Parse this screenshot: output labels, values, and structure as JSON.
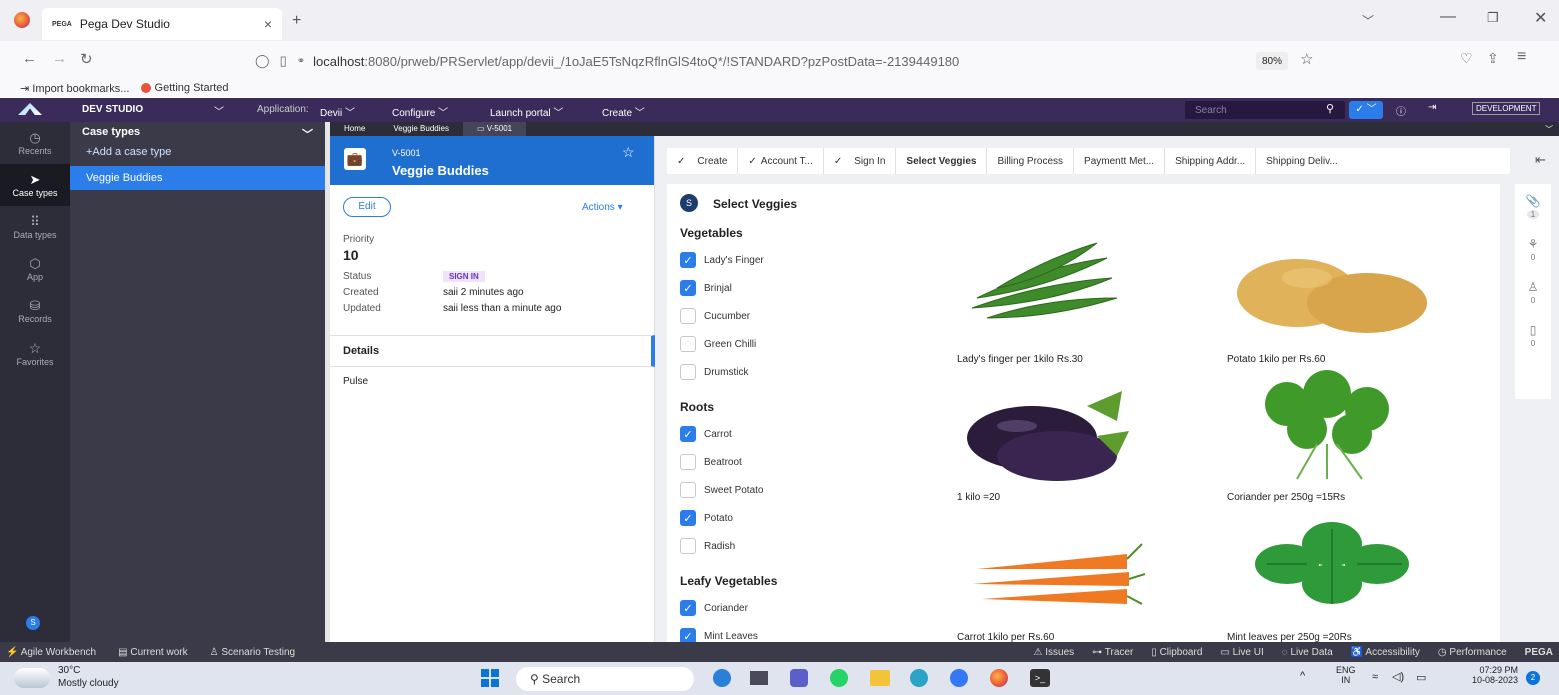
{
  "browser": {
    "tab_title": "Pega Dev Studio",
    "tab_prefix": "PEGA",
    "url_host": "localhost",
    "url_rest": ":8080/prweb/PRServlet/app/devii_/1oJaE5TsNqzRflnGlS4toQ*/!STANDARD?pzPostData=-2139449180",
    "zoom": "80%",
    "bookmarks": [
      "Import bookmarks...",
      "Getting Started"
    ]
  },
  "header": {
    "studio": "DEV STUDIO",
    "application_label": "Application:",
    "application_value": "Devii",
    "menus": [
      "Configure",
      "Launch portal",
      "Create"
    ],
    "search_placeholder": "Search",
    "environment": "DEVELOPMENT"
  },
  "nav": {
    "items": [
      {
        "label": "Recents",
        "icon": "clock-icon"
      },
      {
        "label": "Case types",
        "icon": "case-types-icon"
      },
      {
        "label": "Data types",
        "icon": "grid-icon"
      },
      {
        "label": "App",
        "icon": "cube-icon"
      },
      {
        "label": "Records",
        "icon": "records-icon"
      },
      {
        "label": "Favorites",
        "icon": "star-icon"
      }
    ],
    "avatar": "S"
  },
  "case_types": {
    "title": "Case types",
    "add_label": "+Add a case type",
    "items": [
      "Veggie Buddies"
    ]
  },
  "work_tabs": [
    "Home",
    "Veggie Buddies",
    "V-5001"
  ],
  "case": {
    "id": "V-5001",
    "name": "Veggie Buddies",
    "edit_label": "Edit",
    "actions_label": "Actions",
    "priority_label": "Priority",
    "priority_value": "10",
    "status_label": "Status",
    "status_value": "SIGN IN",
    "created_label": "Created",
    "created_value": "saii 2 minutes ago",
    "updated_label": "Updated",
    "updated_value": "saii less than a minute ago",
    "sections": [
      "Details",
      "Pulse"
    ]
  },
  "stages": [
    {
      "label": "Create",
      "done": true
    },
    {
      "label": "Account T...",
      "done": true
    },
    {
      "label": "Sign In",
      "done": true
    },
    {
      "label": "Select Veggies",
      "done": false,
      "active": true
    },
    {
      "label": "Billing Process",
      "done": false
    },
    {
      "label": "Paymentt Met...",
      "done": false
    },
    {
      "label": "Shipping Addr...",
      "done": false
    },
    {
      "label": "Shipping Deliv...",
      "done": false
    }
  ],
  "form": {
    "badge": "S",
    "title": "Select Veggies",
    "groups": [
      {
        "title": "Vegetables",
        "options": [
          {
            "label": "Lady's Finger",
            "checked": true
          },
          {
            "label": "Brinjal",
            "checked": true
          },
          {
            "label": "Cucumber",
            "checked": false
          },
          {
            "label": "Green Chilli",
            "checked": false
          },
          {
            "label": "Drumstick",
            "checked": false
          }
        ]
      },
      {
        "title": "Roots",
        "options": [
          {
            "label": "Carrot",
            "checked": true
          },
          {
            "label": "Beatroot",
            "checked": false
          },
          {
            "label": "Sweet Potato",
            "checked": false
          },
          {
            "label": "Potato",
            "checked": true
          },
          {
            "label": "Radish",
            "checked": false
          }
        ]
      },
      {
        "title": "Leafy Vegetables",
        "options": [
          {
            "label": "Coriander",
            "checked": true
          },
          {
            "label": "Mint Leaves",
            "checked": true
          }
        ]
      }
    ],
    "products": [
      {
        "caption": "Lady's finger per 1kilo Rs.30",
        "image": "okra"
      },
      {
        "caption": "Potato 1kilo per Rs.60",
        "image": "potato"
      },
      {
        "caption": "1 kilo =20",
        "image": "brinjal"
      },
      {
        "caption": "Coriander per 250g =15Rs",
        "image": "coriander"
      },
      {
        "caption": "Carrot 1kilo per Rs.60",
        "image": "carrot"
      },
      {
        "caption": "Mint leaves per 250g =20Rs",
        "image": "mint"
      }
    ]
  },
  "right_rail": [
    {
      "icon": "paperclip-icon",
      "count": "1"
    },
    {
      "icon": "tag-icon",
      "count": "0"
    },
    {
      "icon": "followers-icon",
      "count": "0"
    },
    {
      "icon": "clipboard-icon",
      "count": "0"
    }
  ],
  "devbar": {
    "left": [
      "Agile Workbench",
      "Current work",
      "Scenario Testing"
    ],
    "right": [
      "Issues",
      "Tracer",
      "Clipboard",
      "Live UI",
      "Live Data",
      "Accessibility",
      "Performance"
    ],
    "brand": "PEGA"
  },
  "taskbar": {
    "temp": "30°C",
    "weather": "Mostly cloudy",
    "search": "Search",
    "lang1": "ENG",
    "lang2": "IN",
    "time": "07:29 PM",
    "date": "10-08-2023",
    "notif": "2"
  },
  "colors": {
    "pega_purple": "#3b2b5a",
    "case_blue": "#1f6fd1",
    "check_blue": "#2b7de9"
  }
}
